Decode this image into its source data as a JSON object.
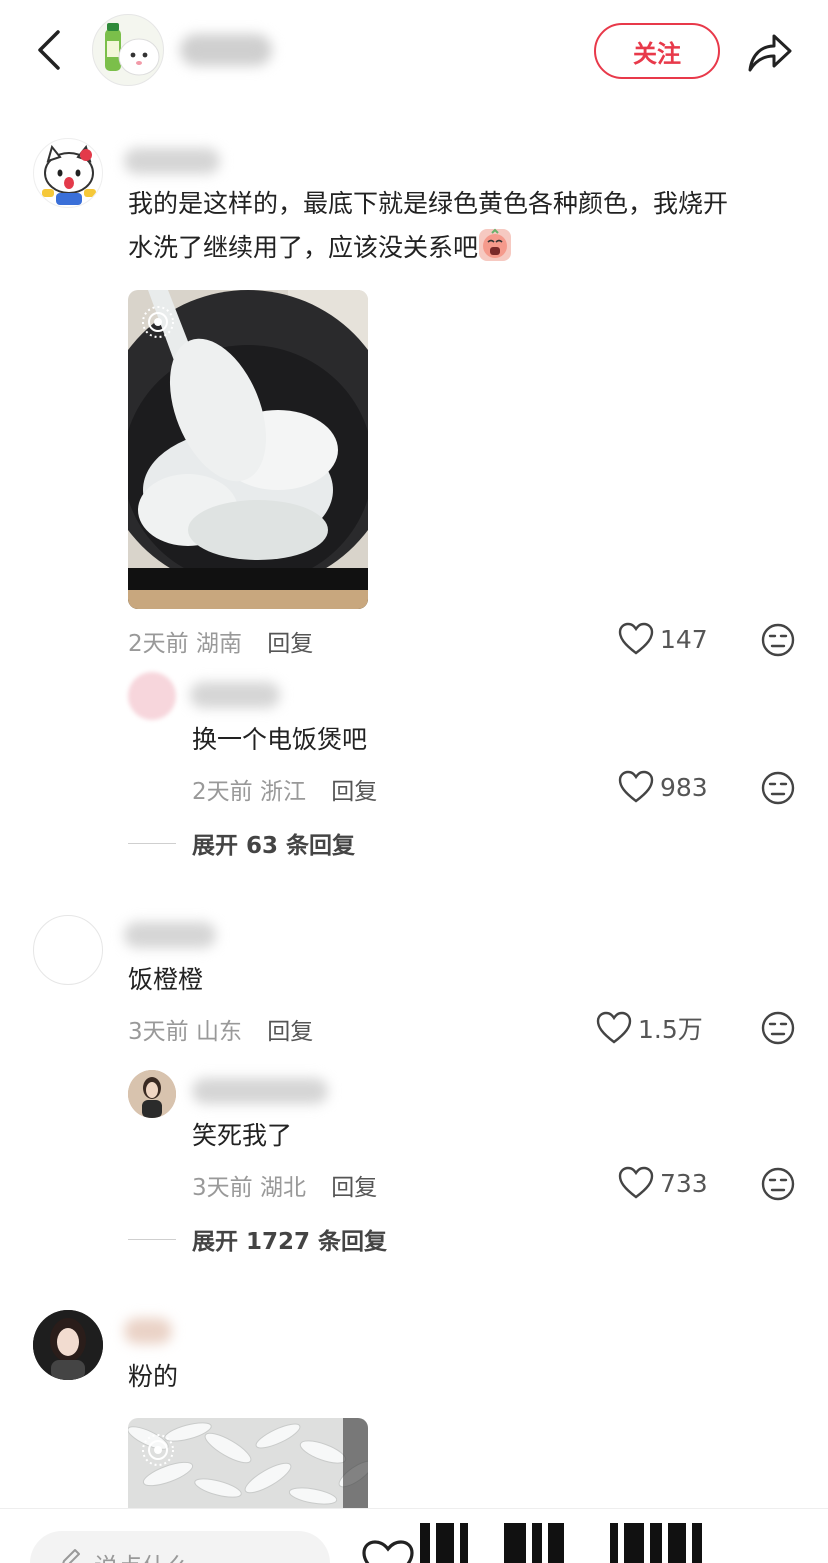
{
  "header": {
    "follow_label": "关注"
  },
  "comments": [
    {
      "text_line1": "我的是这样的，最底下就是绿色黄色各种颜色，我烧开",
      "text_line2": "水洗了继续用了，应该没关系吧",
      "time": "2天前",
      "location": "湖南",
      "reply_label": "回复",
      "likes": "147"
    },
    {
      "text": "饭橙橙",
      "time": "3天前",
      "location": "山东",
      "reply_label": "回复",
      "likes": "1.5万"
    },
    {
      "text": "粉的"
    }
  ],
  "replies": [
    {
      "text": "换一个电饭煲吧",
      "time": "2天前",
      "location": "浙江",
      "reply_label": "回复",
      "likes": "983",
      "expand_label": "展开 63 条回复"
    },
    {
      "text": "笑死我了",
      "time": "3天前",
      "location": "湖北",
      "reply_label": "回复",
      "likes": "733",
      "expand_label": "展开 1727 条回复"
    }
  ],
  "bottom_bar": {
    "input_placeholder": "说点什么"
  },
  "colors": {
    "accent": "#e8394a",
    "muted_text": "#999999"
  },
  "icons": [
    "back-icon",
    "share-icon",
    "heart-icon",
    "meh-face-icon",
    "live-photo-icon",
    "pen-icon"
  ]
}
